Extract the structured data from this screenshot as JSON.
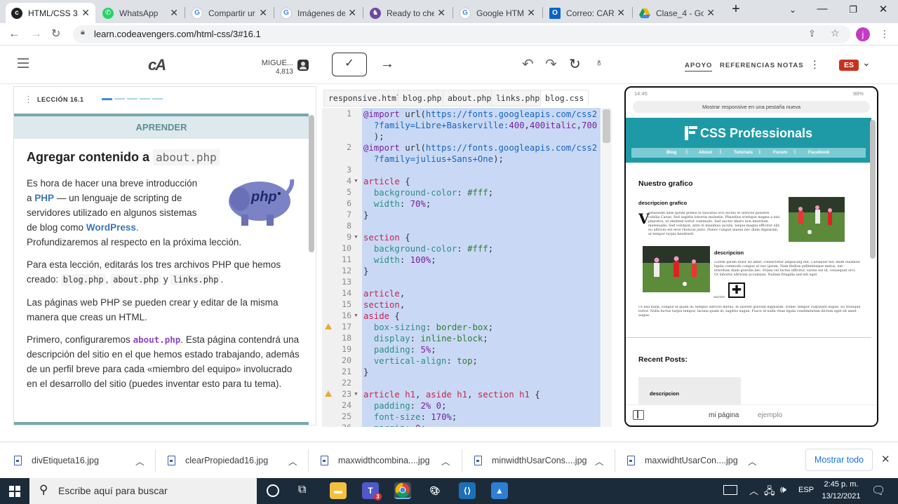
{
  "browser": {
    "tabs": [
      {
        "title": "HTML/CSS 3.",
        "active": true,
        "icon": "codeavengers-icon",
        "color": "#202124"
      },
      {
        "title": "WhatsApp",
        "icon": "whatsapp-icon",
        "color": "#25d366"
      },
      {
        "title": "Compartir ur",
        "icon": "google-icon",
        "color": "#4285f4"
      },
      {
        "title": "Imágenes de",
        "icon": "google-icon",
        "color": "#4285f4"
      },
      {
        "title": "Ready to che",
        "icon": "unicorn-icon",
        "color": "#6b4aa0"
      },
      {
        "title": "Google HTML",
        "icon": "google-icon",
        "color": "#4285f4"
      },
      {
        "title": "Correo: CARL",
        "icon": "outlook-icon",
        "color": "#0a64c8"
      },
      {
        "title": "Clase_4 - Goo",
        "icon": "drive-icon",
        "color": "#f4b400"
      }
    ],
    "url": "learn.codeavengers.com/html-css/3#16.1",
    "profile_initial": "j"
  },
  "app": {
    "logo": "cA",
    "user_name": "MIGUE...",
    "user_points": "4,813",
    "nav": [
      "APOYO",
      "REFERENCIAS",
      "NOTAS"
    ],
    "language": "ES"
  },
  "lesson": {
    "label": "LECCIÓN 16.1",
    "section": "APRENDER",
    "heading_text": "Agregar contenido a",
    "heading_code": "about.php",
    "p1": {
      "a": "Es hora de hacer una breve introducción",
      "b": "a",
      "php": "PHP",
      "c": "— un lenguaje de scripting de",
      "d": "servidores utilizado en algunos sistemas",
      "e": "de blog como",
      "wordpress": "WordPress",
      "f": ".",
      "g": "Profundizaremos al respecto en la próxima lección."
    },
    "p2": {
      "a": "Para esta lección, editarás los tres archivos PHP que hemos",
      "b": "creado:",
      "f1": "blog.php",
      "sep": ",",
      "f2": "about.php",
      "y": "y",
      "f3": "links.php",
      "end": "."
    },
    "p3": "Las páginas web PHP se pueden crear y editar de la misma manera que creas un HTML.",
    "p4": {
      "a": "Primero, configuraremos",
      "file": "about.php",
      "b": ". Esta página contendrá una descripción del sitio en el que hemos estado trabajando, además de un perfil breve para cada «miembro del equipo» involucrado en el desarrollo del sitio (puedes inventar esto para tu tema)."
    },
    "php_logo_text": "php"
  },
  "editor": {
    "tabs": [
      "responsive.html",
      "blog.php",
      "about.php",
      "links.php",
      "blog.css"
    ],
    "active_tab": "blog.css",
    "line_numbers": [
      "1",
      "2",
      "3",
      "4",
      "5",
      "6",
      "7",
      "8",
      "9",
      "10",
      "11",
      "12",
      "13",
      "14",
      "15",
      "16",
      "17",
      "18",
      "19",
      "20",
      "21",
      "22",
      "23",
      "24",
      "25",
      "26"
    ]
  },
  "preview": {
    "time": "14:45",
    "battery": "98%",
    "open_tab_button": "Mostrar responsive en una pestaña nueva",
    "site_title": "CSS Professionals",
    "site_nav": [
      "Blog",
      "About",
      "Tutorials",
      "Forum",
      "Facebook"
    ],
    "graphic_title": "Nuestro grafico",
    "desc_title": "descripcion grafico",
    "dropcap": "V",
    "lorem1": "estibulum ante ipsum primis in faucibus orci luctus et ultrices posuere cubilia Curae; Sed sagittis lobortis molestie. Phasellus tristique magna a nisi pharetra, ut eleifend tortor commodo. Sed auctor libero non interdum malesuada. Sed volutpat, ante in maximus iaculis, neque magna efficitur elit, eu ultrices est eros rhoncus justo. Donec congue massa nec diam dignissim, at tempor turpis hendrerit.",
    "desc2_title": "descripcion",
    "lorem2": "Lorem ipsum dolor sit amet, consectetur adipiscing elit. Curabitur nec enim euismod ligula commodo congue ut nec ipsum. Nam finibus pellentesque metus, nec interdum diam gravida nec. Etiam vel luctus efficitur, varius est id, consequat orci. Ut lobortis ultricies accumsan. Nullam fringilla sed elit eget",
    "auctor": "auctor.",
    "lorem3": "Ut nisl nulla, congue id quam in, tempus ultrices metus. In laoreet gravida dignissim. Donec tempor vulputate augue, eu tristique tortor. Nulla luctus turpis tempor, lacinia quam in, sagittis augue. Fusce id nulla vitae ligula condimentum dictum eget sit amet augue.",
    "recent_title": "Recent Posts:",
    "card_title": "descripcion",
    "footer_tabs": [
      "mi página",
      "ejemplo"
    ]
  },
  "downloads": {
    "files": [
      "divEtiqueta16.jpg",
      "clearPropiedad16.jpg",
      "maxwidthcombina....jpg",
      "minwidthUsarCons....jpg",
      "maxwidhtUsarCon....jpg"
    ],
    "show_all": "Mostrar todo"
  },
  "taskbar": {
    "search_placeholder": "Escribe aquí para buscar",
    "lang": "ESP",
    "time": "2:45 p. m.",
    "date": "13/12/2021",
    "teams_badge": "3"
  }
}
